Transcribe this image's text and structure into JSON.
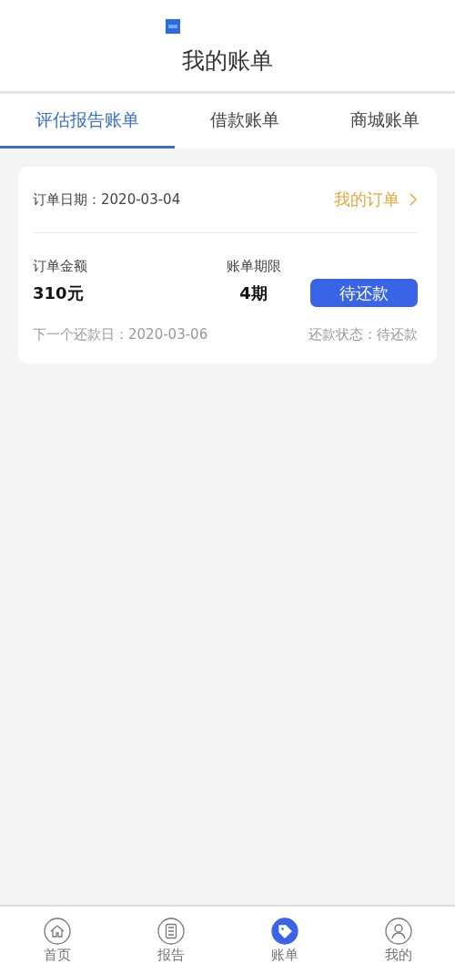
{
  "header": {
    "title": "我的账单"
  },
  "tabs": [
    {
      "label": "评估报告账单",
      "selected": true
    },
    {
      "label": "借款账单",
      "selected": false
    },
    {
      "label": "商城账单",
      "selected": false
    }
  ],
  "bill": {
    "order_date": "订单日期：2020-03-04",
    "order_link": "我的订单",
    "amount_label": "订单金额",
    "amount": "310元",
    "term_label": "账单期限",
    "term": "4期",
    "status_button": "待还款",
    "next_date": "下一个还款日：2020-03-06",
    "status": "还款状态：待还款"
  },
  "bottom_nav": [
    {
      "kind": "home",
      "label": "首页",
      "selected": false
    },
    {
      "kind": "report",
      "label": "报告",
      "selected": false
    },
    {
      "kind": "bill",
      "label": "账单",
      "selected": true
    },
    {
      "kind": "profile",
      "label": "我的",
      "selected": false
    }
  ]
}
